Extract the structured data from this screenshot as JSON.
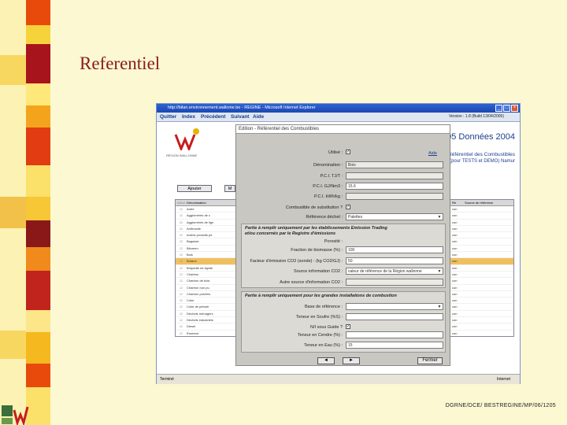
{
  "slide": {
    "title": "Referentiel",
    "footer": "DGRNE/DCE/ BESTREGINE/MP/06/1205"
  },
  "browser": {
    "window_title": "http://bilan.environnement.wallonie.be - REGINE - Microsoft Internet Explorer",
    "menu": [
      "Quitter",
      "Index",
      "Précédent",
      "Suivant",
      "Aide"
    ],
    "version": "Version : 1.8 (Build 13/04/2005)",
    "logo_caption": "RÉGION WALLONNE",
    "header_title": "te 2005 Données 2004",
    "header_sub1": "( Référentiel des Combustibles",
    "header_sub2": "(pour TESTS et DEMO) Namur",
    "buttons": {
      "add": "Ajouter",
      "modify": "M"
    },
    "list_headers": [
      "Utilisé",
      "Dénomination"
    ],
    "list_items": [
      "Autre",
      "Agglomérés de c",
      "Agglomérés de lign",
      "Anthracite",
      "Autres produits pé",
      "Bagasse",
      "Bitumen",
      "Bois",
      "Butane",
      "Briquette de lignite",
      "Charbon",
      "Charbon de bois",
      "Charbon non pu",
      "Charbon pulvéris",
      "Coke",
      "Coke de pétrole",
      "Déchets ménagers",
      "Déchets industriels",
      "Diesel",
      "Essence",
      "Essence BF",
      "Fuel lourd TBTS"
    ],
    "selected_index": 8,
    "right_headers": [
      "Ré",
      "Source de référence"
    ],
    "right_items": [
      "con",
      "con",
      "con",
      "con",
      "con",
      "con",
      "con",
      "con",
      "con",
      "con",
      "con",
      "con",
      "con",
      "con",
      "con",
      "con",
      "con",
      "con",
      "con",
      "con",
      "con",
      "con"
    ],
    "status_left": "Terminé",
    "status_right": "Internet"
  },
  "dialog": {
    "title": "Edition - Référentiel des Combustibles",
    "aide": "Aide",
    "fields": {
      "utilise": {
        "label": "Utilisé :",
        "checked": true
      },
      "denomination": {
        "label": "Dénomination :",
        "value": "Bois"
      },
      "pci_tj_t": {
        "label": "P.C.I. TJ/T :",
        "value": ""
      },
      "pci_gj_nm3": {
        "label": "P.C.I. GJ/Nm3 :",
        "value": "15.6"
      },
      "pci_kwh_kg": {
        "label": "P.C.I. kWh/kg :",
        "value": ""
      },
      "combustible_fixe": {
        "label": "Combustible de substitution ?",
        "checked": true
      },
      "reference_dechet": {
        "label": "Référence déchet :",
        "value": "Palettes"
      }
    },
    "section1": {
      "title_line1": "Partie à remplir uniquement par les établissements Emission Trading",
      "title_line2": "et/ou concernés par le Registre d'émissions",
      "porosite": {
        "label": "Porosité :",
        "value": ""
      },
      "fraction_biomasse": {
        "label": "Fraction de biomasse (%) :",
        "value": "100"
      },
      "facteur_emission": {
        "label": "Facteur d'émission CO2 (sonde) : (kg CO2/GJ) :",
        "value": "50"
      },
      "source_info": {
        "label": "Source information CO2 :",
        "value": "valeur de référence de la Région wallonne"
      },
      "facteur_oxydation": {
        "label": "Autre source d'information CO2 :",
        "value": ""
      }
    },
    "section2": {
      "title": "Partie à remplir uniquement pour les grandes installations de combustion",
      "base_reference": {
        "label": "Base de référence :",
        "value": ""
      },
      "teneur_soufre": {
        "label": "Teneur en Soufre (%S) :",
        "value": ""
      },
      "nox": {
        "label": "N/I sous Guide ?",
        "checked": true
      },
      "teneur_cendre": {
        "label": "Teneur en Cendre (%) :",
        "value": ""
      },
      "teneur_eau": {
        "label": "Teneur en Eau (%) :",
        "value": "15"
      }
    },
    "nav": {
      "prev": "◄",
      "next": "►",
      "close": "Fermer"
    }
  },
  "colors": {
    "background": "#fbf8d2",
    "title": "#8b1a1a",
    "strip": [
      "#e84a0c",
      "#f4a41c",
      "#b01c24",
      "#fbe06a",
      "#ffd23c",
      "#8a1818"
    ],
    "selected_row": "#f0c060"
  }
}
